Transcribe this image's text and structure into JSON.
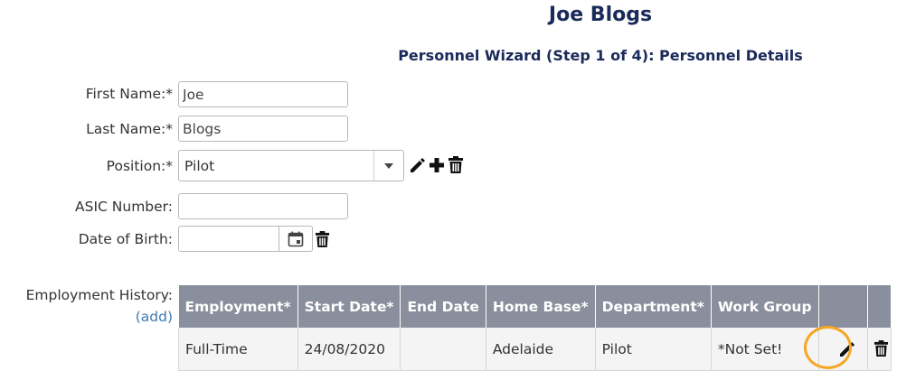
{
  "header": {
    "title": "Joe Blogs",
    "subtitle": "Personnel Wizard (Step 1 of 4): Personnel Details"
  },
  "form": {
    "first_name": {
      "label": "First Name:*",
      "value": "Joe"
    },
    "last_name": {
      "label": "Last Name:*",
      "value": "Blogs"
    },
    "position": {
      "label": "Position:*",
      "value": "Pilot",
      "icons": [
        "pencil-icon",
        "plus-icon",
        "trash-icon"
      ]
    },
    "asic_number": {
      "label": "ASIC Number:",
      "value": ""
    },
    "date_of_birth": {
      "label": "Date of Birth:",
      "value": "",
      "icons": [
        "calendar-icon",
        "trash-icon"
      ]
    }
  },
  "employment_history": {
    "label": "Employment History:",
    "add_link": "(add)",
    "columns": [
      "Employment*",
      "Start Date*",
      "End Date",
      "Home Base*",
      "Department*",
      "Work Group",
      "",
      ""
    ],
    "rows": [
      {
        "employment": "Full-Time",
        "start_date": "24/08/2020",
        "end_date": "",
        "home_base": "Adelaide",
        "department": "Pilot",
        "work_group": "*Not Set!"
      }
    ]
  },
  "colors": {
    "title": "#1a2a5a",
    "table_header": "#8a8f9d",
    "link": "#3e7bb3",
    "highlight_ring": "#f5a623"
  }
}
